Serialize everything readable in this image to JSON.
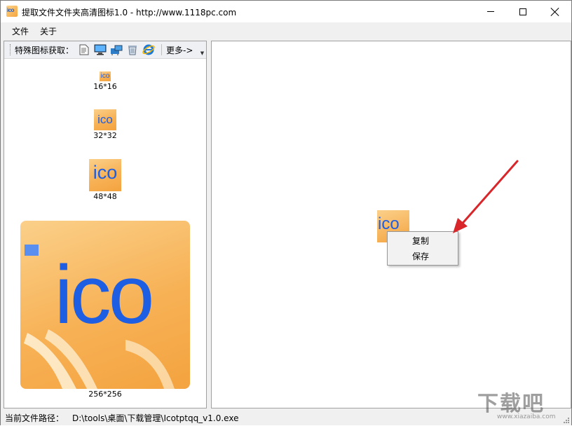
{
  "window": {
    "title": "提取文件文件夹高清图标1.0 - http://www.1118pc.com",
    "app_icon_text": "ico"
  },
  "menu": [
    "文件",
    "关于"
  ],
  "toolbar": {
    "label": "特殊图标获取：",
    "icons": [
      "document-icon",
      "computer-icon",
      "network-folder-icon",
      "recycle-bin-icon",
      "internet-explorer-icon"
    ],
    "more_label": "更多->"
  },
  "icons_list": [
    {
      "size": "16*16",
      "text": "ico"
    },
    {
      "size": "32*32",
      "text": "ico"
    },
    {
      "size": "48*48",
      "text": "ico"
    },
    {
      "size": "256*256",
      "text": "ico"
    }
  ],
  "preview": {
    "text": "ico"
  },
  "context_menu": [
    "复制",
    "保存"
  ],
  "status": {
    "label": "当前文件路径：",
    "path": "D:\\tools\\桌面\\下载管理\\Icotptqq_v1.0.exe"
  },
  "watermark": {
    "text": "下载吧",
    "sub": "www.xiazaiba.com"
  },
  "colors": {
    "accent_blue": "#1d5ee3",
    "tile_orange": "#f7b155",
    "arrow_red": "#d8262a"
  }
}
